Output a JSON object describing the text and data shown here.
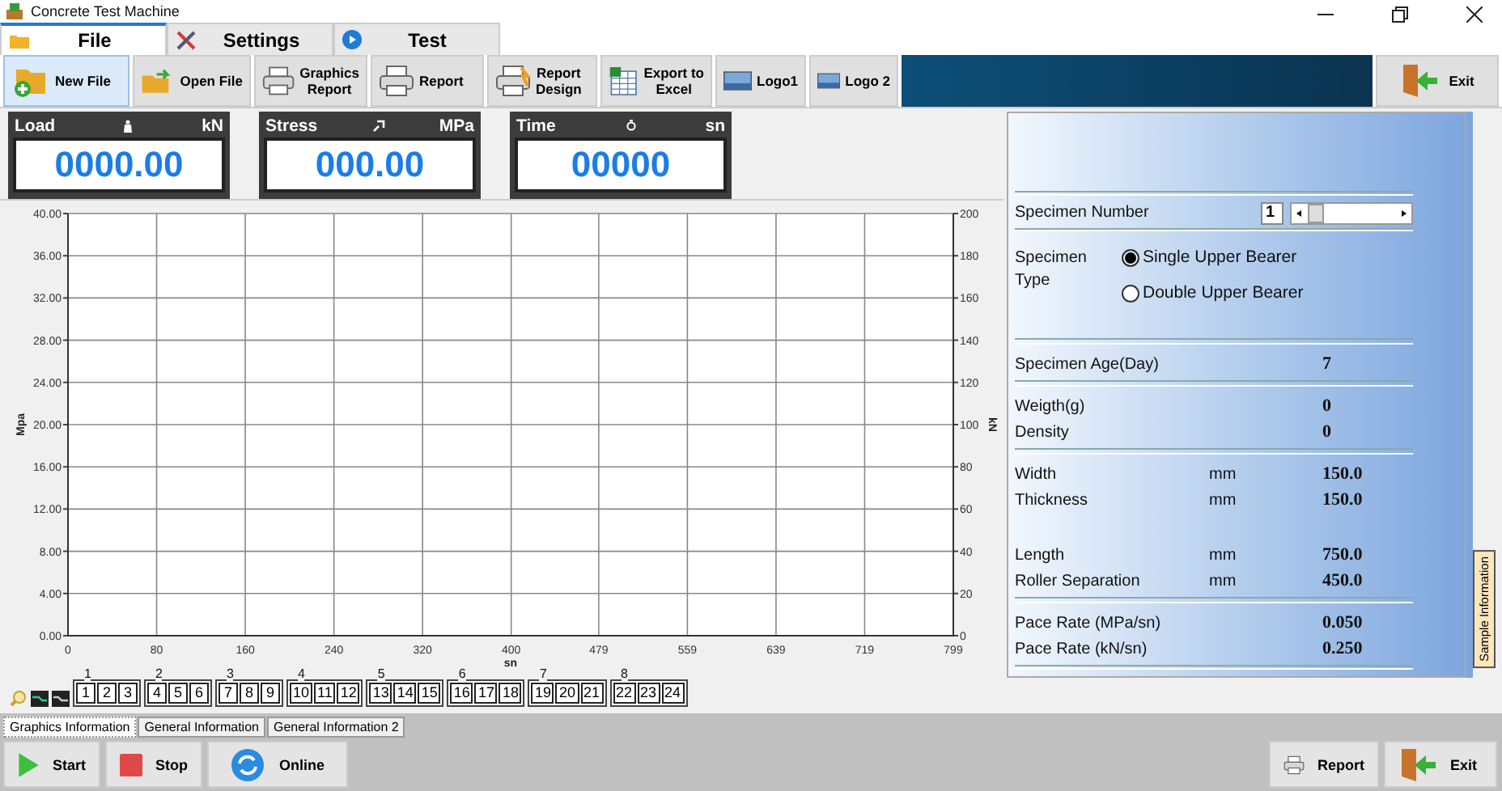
{
  "window": {
    "title": "Concrete Test Machine"
  },
  "tabs": [
    {
      "label": "File",
      "selected": true
    },
    {
      "label": "Settings",
      "selected": false
    },
    {
      "label": "Test",
      "selected": false
    }
  ],
  "toolbar": [
    {
      "label": "New File",
      "selected": true
    },
    {
      "label": "Open File",
      "selected": false
    },
    {
      "label": "Graphics\nReport",
      "selected": false
    },
    {
      "label": "Report",
      "selected": false
    },
    {
      "label": "Report\nDesign",
      "selected": false
    },
    {
      "label": "Export to\nExcel",
      "selected": false
    },
    {
      "label": "Logo1",
      "selected": false
    },
    {
      "label": "Logo 2",
      "selected": false
    }
  ],
  "exit_button": "Exit",
  "gauges": [
    {
      "label": "Load",
      "unit": "kN",
      "value": "0000.00"
    },
    {
      "label": "Stress",
      "unit": "MPa",
      "value": "000.00"
    },
    {
      "label": "Time",
      "unit": "sn",
      "value": "00000"
    }
  ],
  "chart": {
    "chart_data": {
      "type": "line",
      "xlabel": "sn",
      "ylabel": "Mpa",
      "y2label": "kN",
      "xlim": [
        0,
        799
      ],
      "ylim": [
        0,
        40
      ],
      "y2lim": [
        0,
        200
      ],
      "grid": true,
      "xticks": [
        0,
        80,
        160,
        240,
        320,
        400,
        479,
        559,
        639,
        719,
        799
      ],
      "yticks": [
        {
          "value": 0,
          "label": "0.00"
        },
        {
          "value": 4,
          "label": "4.00"
        },
        {
          "value": 8,
          "label": "8.00"
        },
        {
          "value": 12,
          "label": "12.00"
        },
        {
          "value": 16,
          "label": "16.00"
        },
        {
          "value": 20,
          "label": "20.00"
        },
        {
          "value": 24,
          "label": "24.00"
        },
        {
          "value": 28,
          "label": "28.00"
        },
        {
          "value": 32,
          "label": "32.00"
        },
        {
          "value": 36,
          "label": "36.00"
        },
        {
          "value": 40,
          "label": "40.00"
        }
      ],
      "y2ticks": [
        0,
        20,
        40,
        60,
        80,
        100,
        120,
        140,
        160,
        180,
        200
      ]
    }
  },
  "specimen_groups": [
    {
      "label": "1",
      "items": [
        "1",
        "2",
        "3"
      ]
    },
    {
      "label": "2",
      "items": [
        "4",
        "5",
        "6"
      ]
    },
    {
      "label": "3",
      "items": [
        "7",
        "8",
        "9"
      ]
    },
    {
      "label": "4",
      "items": [
        "10",
        "11",
        "12"
      ]
    },
    {
      "label": "5",
      "items": [
        "13",
        "14",
        "15"
      ]
    },
    {
      "label": "6",
      "items": [
        "16",
        "17",
        "18"
      ]
    },
    {
      "label": "7",
      "items": [
        "19",
        "20",
        "21"
      ]
    },
    {
      "label": "8",
      "items": [
        "22",
        "23",
        "24"
      ]
    }
  ],
  "bottom_tabs": [
    {
      "label": "Graphics Information",
      "selected": true
    },
    {
      "label": "General Information",
      "selected": false
    },
    {
      "label": "General Information 2",
      "selected": false
    }
  ],
  "actions_left": [
    "Start",
    "Stop",
    "Online"
  ],
  "actions_right": [
    "Report",
    "Exit"
  ],
  "specimen": {
    "number_label": "Specimen Number",
    "number_value": "1",
    "type_label": "Specimen\nType",
    "types": [
      {
        "label": "Single Upper Bearer",
        "selected": true
      },
      {
        "label": "Double Upper Bearer",
        "selected": false
      }
    ],
    "sections": [
      {
        "divider": true,
        "rows": [
          {
            "label": "Specimen Age(Day)",
            "value": "7"
          }
        ]
      },
      {
        "divider": true,
        "rows": [
          {
            "label": "Weigth(g)",
            "value": "0"
          },
          {
            "label": "Density",
            "value": "0"
          }
        ]
      },
      {
        "divider": true,
        "rows": [
          {
            "label": "Width",
            "unit": "mm",
            "value": "150.0"
          },
          {
            "label": "Thickness",
            "unit": "mm",
            "value": "150.0"
          }
        ]
      },
      {
        "divider": false,
        "rows": [
          {
            "label": "Length",
            "unit": "mm",
            "value": "750.0"
          },
          {
            "label": "Roller Separation",
            "unit": "mm",
            "value": "450.0"
          }
        ]
      },
      {
        "divider": true,
        "rows": [
          {
            "label": "Pace Rate (MPa/sn)",
            "value": "0.050"
          },
          {
            "label": "Pace Rate (kN/sn)",
            "value": "0.250"
          }
        ]
      }
    ]
  },
  "side_tab": "Sample Information"
}
